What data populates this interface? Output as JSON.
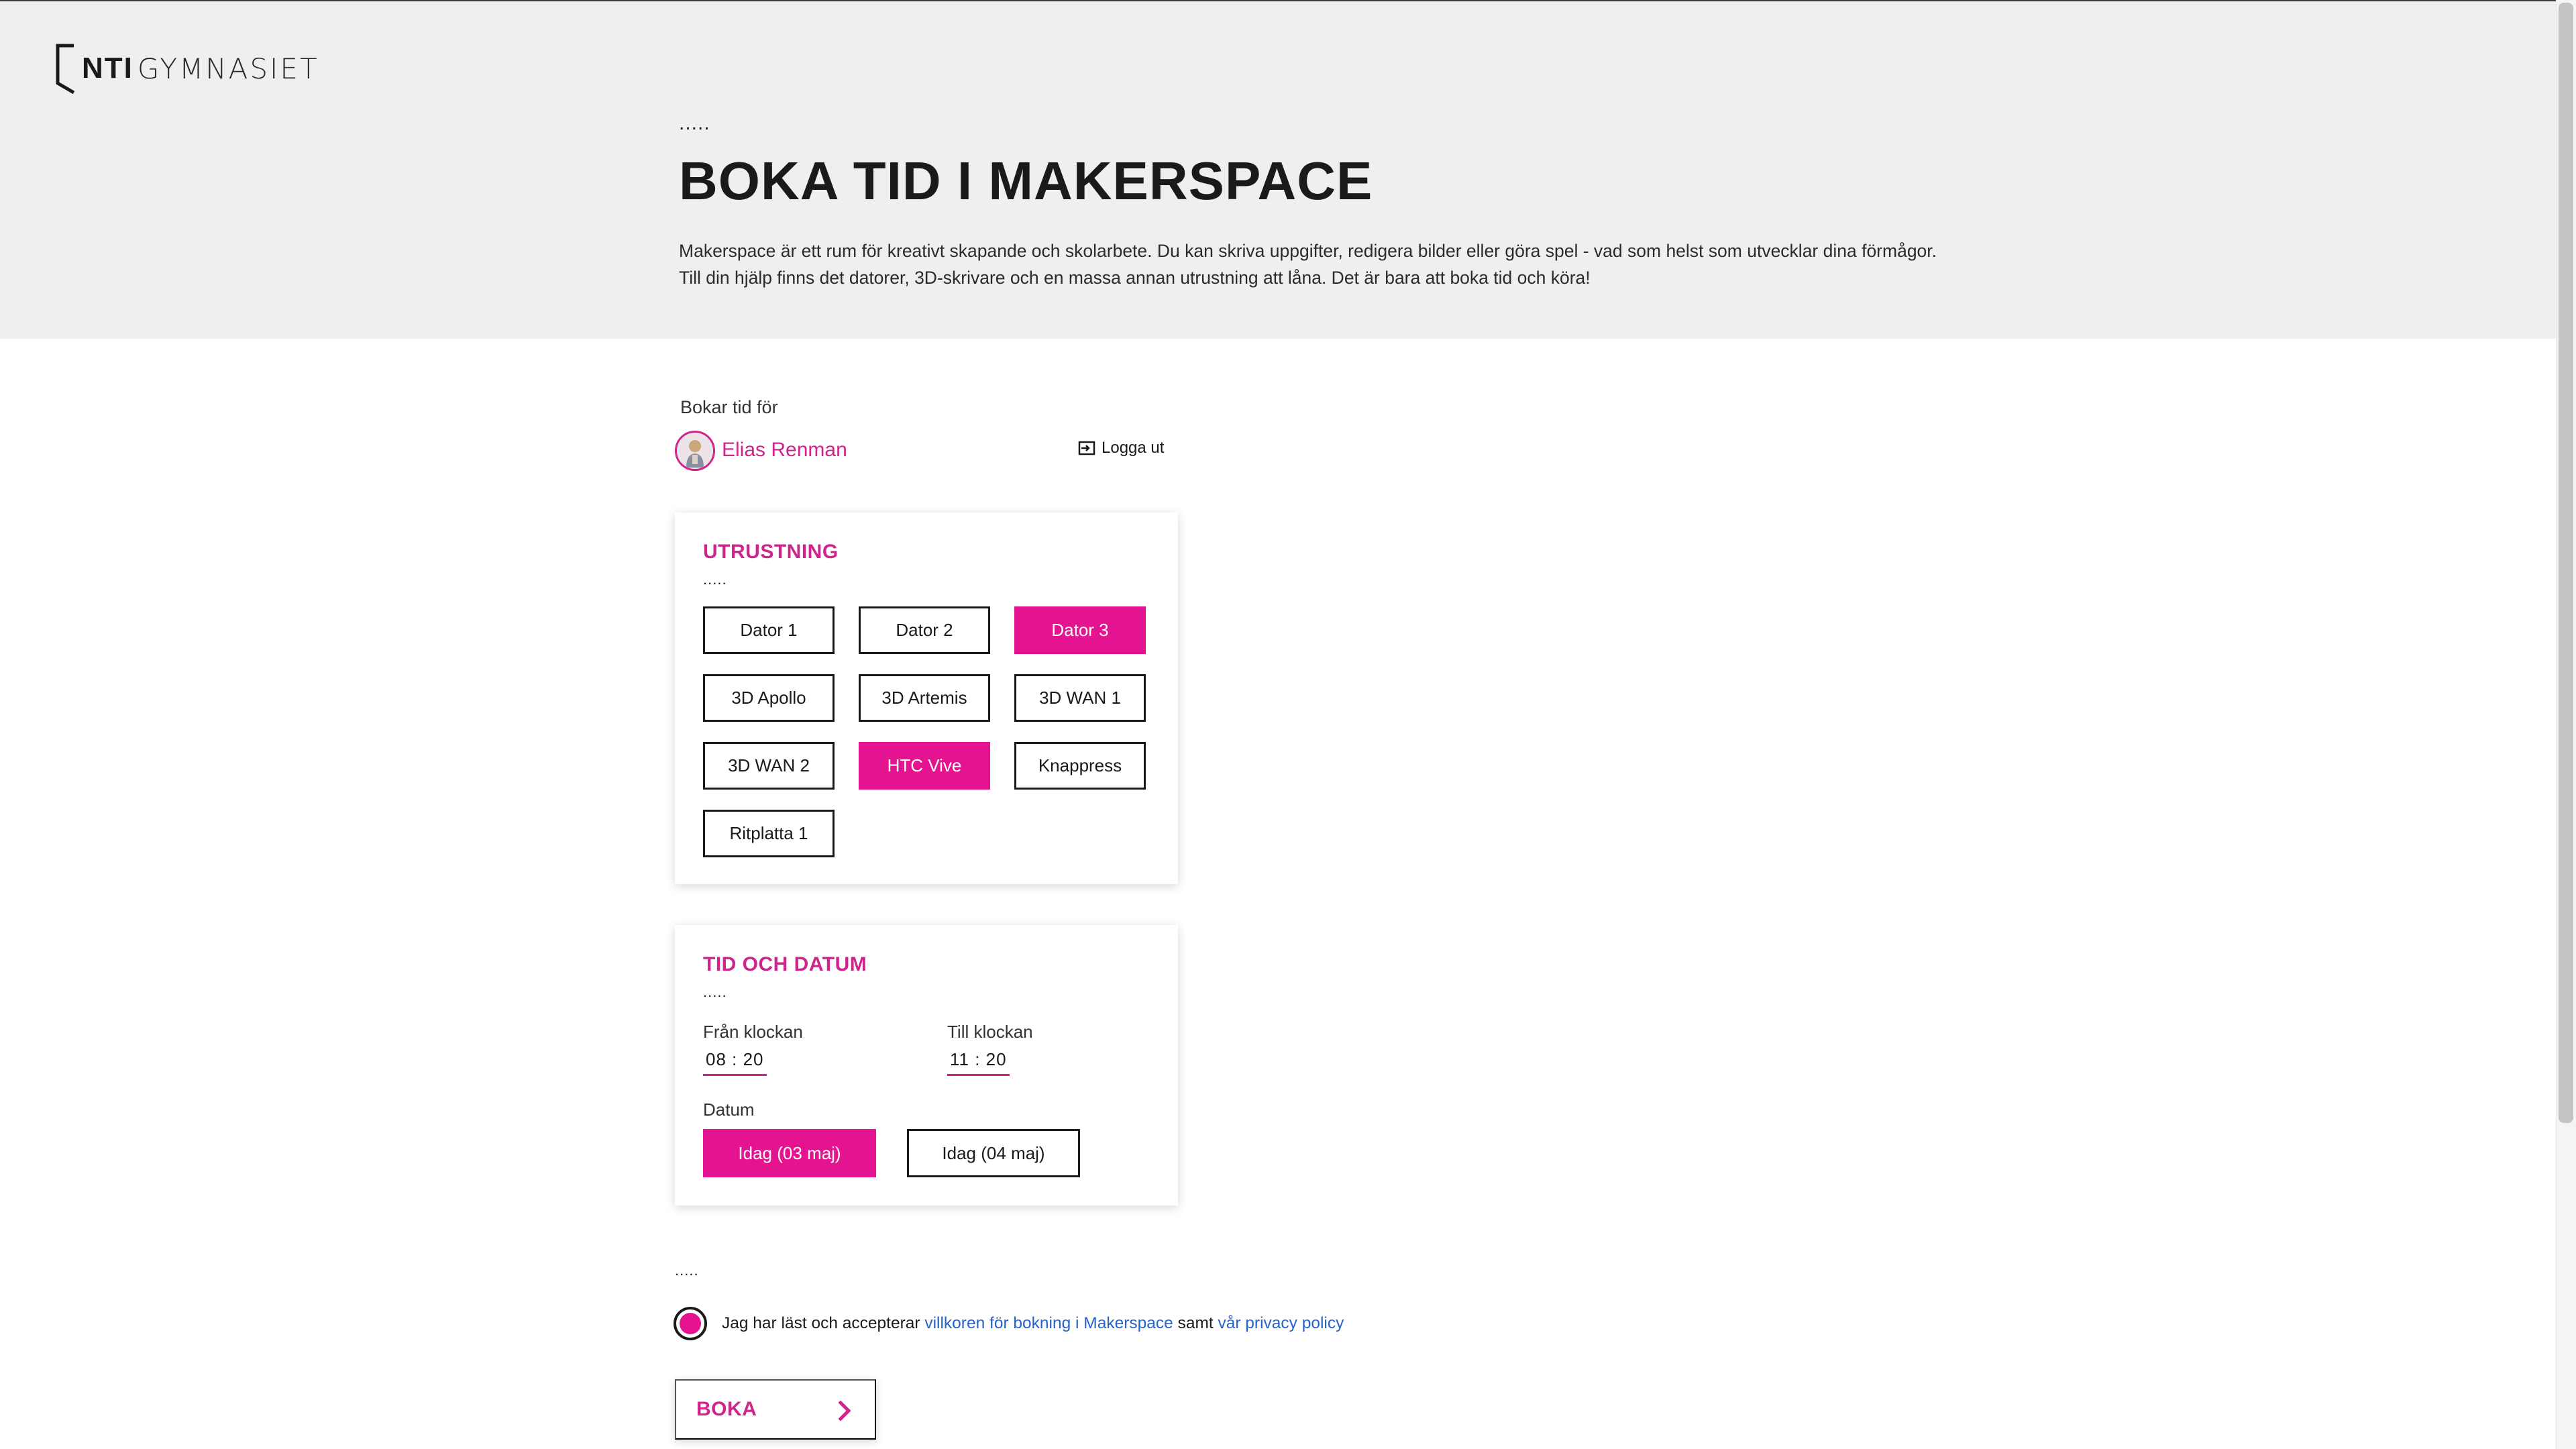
{
  "brand": {
    "logo_bold": "NTI",
    "logo_light": "GYMNASIET"
  },
  "colors": {
    "accent": "#e4138f",
    "accent_text": "#d0248c",
    "link": "#2563c9",
    "hero_bg": "#efefef"
  },
  "hero": {
    "dots": ".....",
    "title": "BOKA TID I MAKERSPACE",
    "description_line1": "Makerspace är ett rum för kreativt skapande och skolarbete. Du kan skriva uppgifter, redigera bilder eller göra spel - vad som helst som utvecklar dina förmågor.",
    "description_line2": "Till din hjälp finns det datorer, 3D-skrivare och en massa annan utrustning att låna. Det är bara att boka tid och köra!"
  },
  "user": {
    "booking_for_label": "Bokar tid för",
    "name": "Elias Renman",
    "logout_label": "Logga ut",
    "logout_icon": "logout-icon"
  },
  "equipment": {
    "title": "UTRUSTNING",
    "dots": ".....",
    "items": [
      {
        "label": "Dator 1",
        "selected": false
      },
      {
        "label": "Dator 2",
        "selected": false
      },
      {
        "label": "Dator 3",
        "selected": true
      },
      {
        "label": "3D Apollo",
        "selected": false
      },
      {
        "label": "3D Artemis",
        "selected": false
      },
      {
        "label": "3D WAN 1",
        "selected": false
      },
      {
        "label": "3D WAN 2",
        "selected": false
      },
      {
        "label": "HTC Vive",
        "selected": true
      },
      {
        "label": "Knappress",
        "selected": false
      },
      {
        "label": "Ritplatta 1",
        "selected": false
      }
    ]
  },
  "time": {
    "title": "TID OCH DATUM",
    "dots": ".....",
    "from_label": "Från klockan",
    "from_value": "08 : 20",
    "to_label": "Till klockan",
    "to_value": "11 : 20",
    "date_label": "Datum",
    "dates": [
      {
        "label": "Idag (03 maj)",
        "selected": true
      },
      {
        "label": "Idag (04 maj)",
        "selected": false
      }
    ]
  },
  "terms": {
    "dots": ".....",
    "prefix": "Jag har läst och accepterar",
    "link1": "villkoren för bokning i Makerspace",
    "middle": "samt",
    "link2": "vår privacy policy",
    "checked": true
  },
  "submit": {
    "label": "BOKA",
    "icon": "chevron-right-icon"
  }
}
